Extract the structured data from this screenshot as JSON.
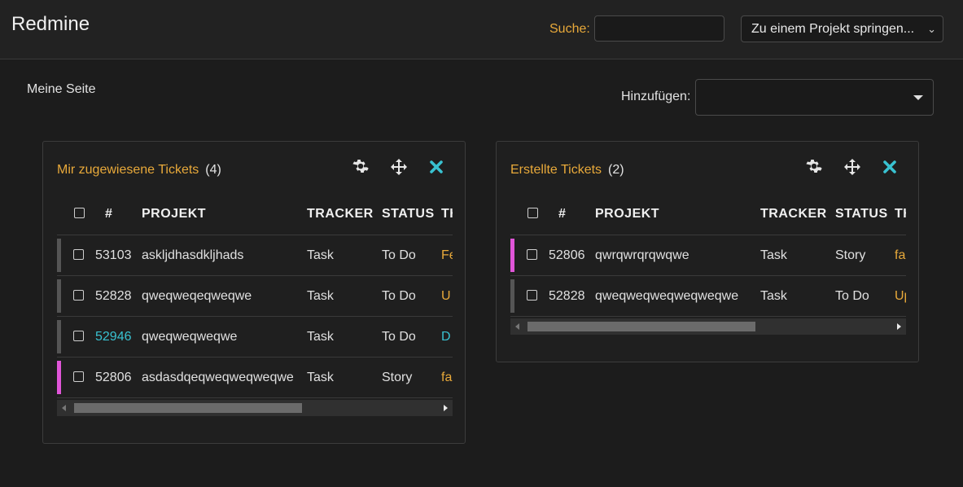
{
  "header": {
    "app_title": "Redmine",
    "search_label": "Suche:",
    "search_value": "",
    "jump_label": "Zu einem Projekt springen..."
  },
  "page": {
    "title": "Meine Seite",
    "add_label": "Hinzufügen:",
    "add_value": ""
  },
  "colors": {
    "accent_orange": "#e8a93a",
    "link_cyan": "#39c2d1",
    "story_bar": "#e055d8",
    "task_bar": "#555555"
  },
  "icons": {
    "settings": "gear-icon",
    "move": "move-arrows-icon",
    "close": "close-x-icon"
  },
  "columns": [
    "#",
    "PROJEKT",
    "TRACKER",
    "STATUS",
    "TH"
  ],
  "assigned": {
    "title": "Mir zugewiesene Tickets",
    "count": "(4)",
    "rows": [
      {
        "id": "53103",
        "project": "askljdhasdkljhads",
        "tracker": "Task",
        "status": "To Do",
        "trunc": "Fe",
        "trunc_style": "orange",
        "bar": "task",
        "id_link": false
      },
      {
        "id": "52828",
        "project": "qweqweqeqweqwe",
        "tracker": "Task",
        "status": "To Do",
        "trunc": "U",
        "trunc_style": "orange",
        "bar": "task",
        "id_link": false
      },
      {
        "id": "52946",
        "project": "qweqweqweqwe",
        "tracker": "Task",
        "status": "To Do",
        "trunc": "D",
        "trunc_style": "cyan",
        "bar": "task",
        "id_link": true
      },
      {
        "id": "52806",
        "project": "asdasdqeqweqweqweqwe",
        "tracker": "Task",
        "status": "Story",
        "trunc": "fa",
        "trunc_style": "orange",
        "bar": "story",
        "id_link": false
      }
    ]
  },
  "created": {
    "title": "Erstellte Tickets",
    "count": "(2)",
    "rows": [
      {
        "id": "52806",
        "project": "qwrqwrqrqwqwe",
        "tracker": "Task",
        "status": "Story",
        "trunc": "fab",
        "trunc_style": "orange",
        "bar": "story",
        "id_link": false
      },
      {
        "id": "52828",
        "project": "qweqweqweqweqweqwe",
        "tracker": "Task",
        "status": "To Do",
        "trunc": "Upo",
        "trunc_style": "orange",
        "bar": "task",
        "id_link": false
      }
    ]
  }
}
